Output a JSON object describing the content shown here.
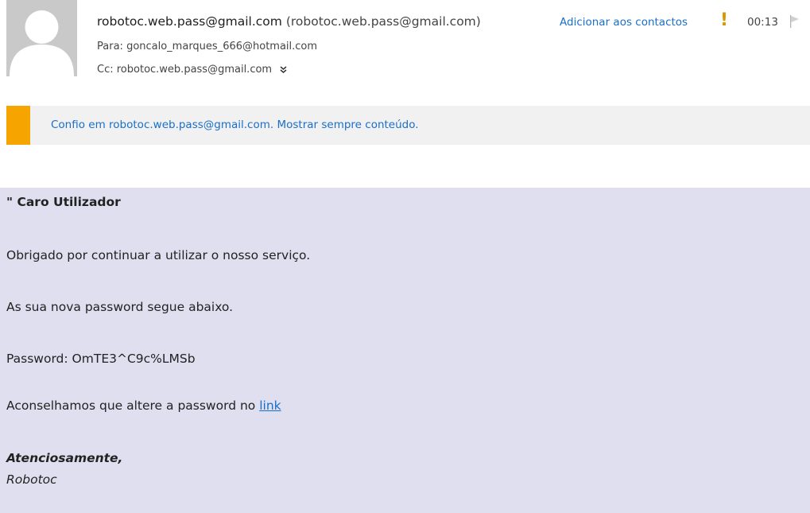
{
  "header": {
    "sender_name": "robotoc.web.pass@gmail.com",
    "sender_address": "(robotoc.web.pass@gmail.com)",
    "add_contact_label": "Adicionar aos contactos",
    "importance_mark": "!",
    "time": "00:13",
    "to_label": "Para:",
    "to_value": "goncalo_marques_666@hotmail.com",
    "cc_label": "Cc:",
    "cc_value": "robotoc.web.pass@gmail.com",
    "expand_glyph": "»",
    "icons": {
      "avatar": "person-silhouette-icon",
      "importance": "exclamation-icon",
      "flag": "flag-icon",
      "expand": "chevron-down-icon"
    },
    "colors": {
      "importance": "#d89700",
      "link": "#1a6fc9"
    }
  },
  "trust_bar": {
    "text": "Confio em robotoc.web.pass@gmail.com. Mostrar sempre conteúdo.",
    "stripe_color": "#f6a500",
    "background": "#f1f1f1"
  },
  "message": {
    "background": "#e0dff0",
    "greeting": "\" Caro Utilizador",
    "line1": "Obrigado por continuar a utilizar o nosso serviço.",
    "line2": "As sua nova password segue abaixo.",
    "line3": "Password: OmTE3^C9c%LMSb",
    "line4_prefix": "Aconselhamos que altere a password no ",
    "line4_link": "link",
    "signoff": "Atenciosamente,",
    "signature": "Robotoc"
  }
}
